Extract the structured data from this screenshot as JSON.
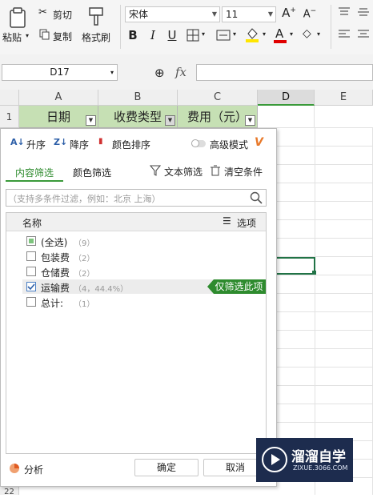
{
  "ribbon": {
    "paste": "粘贴",
    "cut": "剪切",
    "copy": "复制",
    "format_painter": "格式刷",
    "font_name": "宋体",
    "font_size": "11",
    "bold": "B",
    "italic": "I",
    "underline": "U",
    "grow_font": "A",
    "shrink_font": "A"
  },
  "formula_bar": {
    "name_box": "D17",
    "fx": "fx"
  },
  "sheet": {
    "columns": [
      "A",
      "B",
      "C",
      "D",
      "E"
    ],
    "row1_number": "1",
    "last_row_number": "22",
    "headers": [
      "日期",
      "收费类型",
      "费用（元）"
    ]
  },
  "filter_panel": {
    "sort_asc": "升序",
    "sort_desc": "降序",
    "color_sort": "颜色排序",
    "advanced": "高级模式",
    "tab_content": "内容筛选",
    "tab_color": "颜色筛选",
    "text_filter": "文本筛选",
    "clear": "清空条件",
    "search_placeholder": "（支持多条件过滤，例如：北京 上海）",
    "list_header": "名称",
    "options": "选项",
    "items": [
      {
        "label": "(全选)",
        "count": "（9）",
        "state": "partial"
      },
      {
        "label": "包装费",
        "count": "（2）",
        "state": "unchecked"
      },
      {
        "label": "仓储费",
        "count": "（2）",
        "state": "unchecked"
      },
      {
        "label": "运输费",
        "count": "（4，44.4%）",
        "state": "checked"
      },
      {
        "label": "总计:",
        "count": "（1）",
        "state": "unchecked"
      }
    ],
    "only_this": "仅筛选此项",
    "analysis": "分析",
    "ok": "确定",
    "cancel": "取消"
  },
  "watermark": {
    "brand": "溜溜自学",
    "url": "ZIXUE.3066.COM"
  },
  "colors": {
    "header_fill": "#c6e0b4",
    "accent_green": "#2e8b2e",
    "tab_underline": "#3a9a3a",
    "watermark_bg": "#1d2c4e"
  }
}
